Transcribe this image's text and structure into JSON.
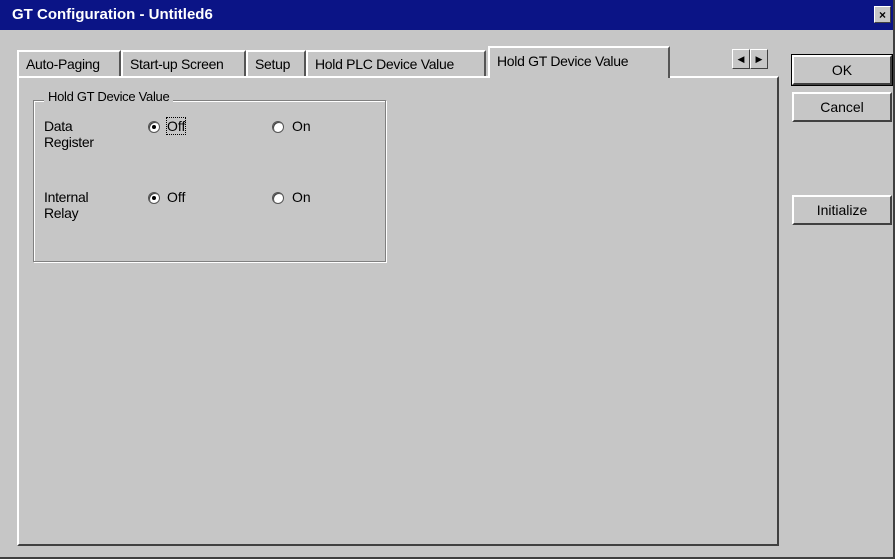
{
  "window": {
    "title": "GT Configuration - Untitled6",
    "close_glyph": "×"
  },
  "tabs": [
    {
      "label": "Auto-Paging",
      "active": false
    },
    {
      "label": "Start-up Screen",
      "active": false
    },
    {
      "label": "Setup",
      "active": false
    },
    {
      "label": "Hold PLC Device Value",
      "active": false
    },
    {
      "label": "Hold GT Device Value",
      "active": true
    }
  ],
  "tab_scroll": {
    "left_glyph": "◀",
    "right_glyph": "▶"
  },
  "group": {
    "title": "Hold GT Device Value",
    "rows": [
      {
        "label": "Data Register",
        "off_label": "Off",
        "on_label": "On",
        "selected": "Off"
      },
      {
        "label": "Internal Relay",
        "off_label": "Off",
        "on_label": "On",
        "selected": "Off"
      }
    ]
  },
  "buttons": {
    "ok": "OK",
    "cancel": "Cancel",
    "initialize": "Initialize"
  },
  "colors": {
    "titlebar": "#0b1486",
    "face": "#c6c6c6"
  }
}
